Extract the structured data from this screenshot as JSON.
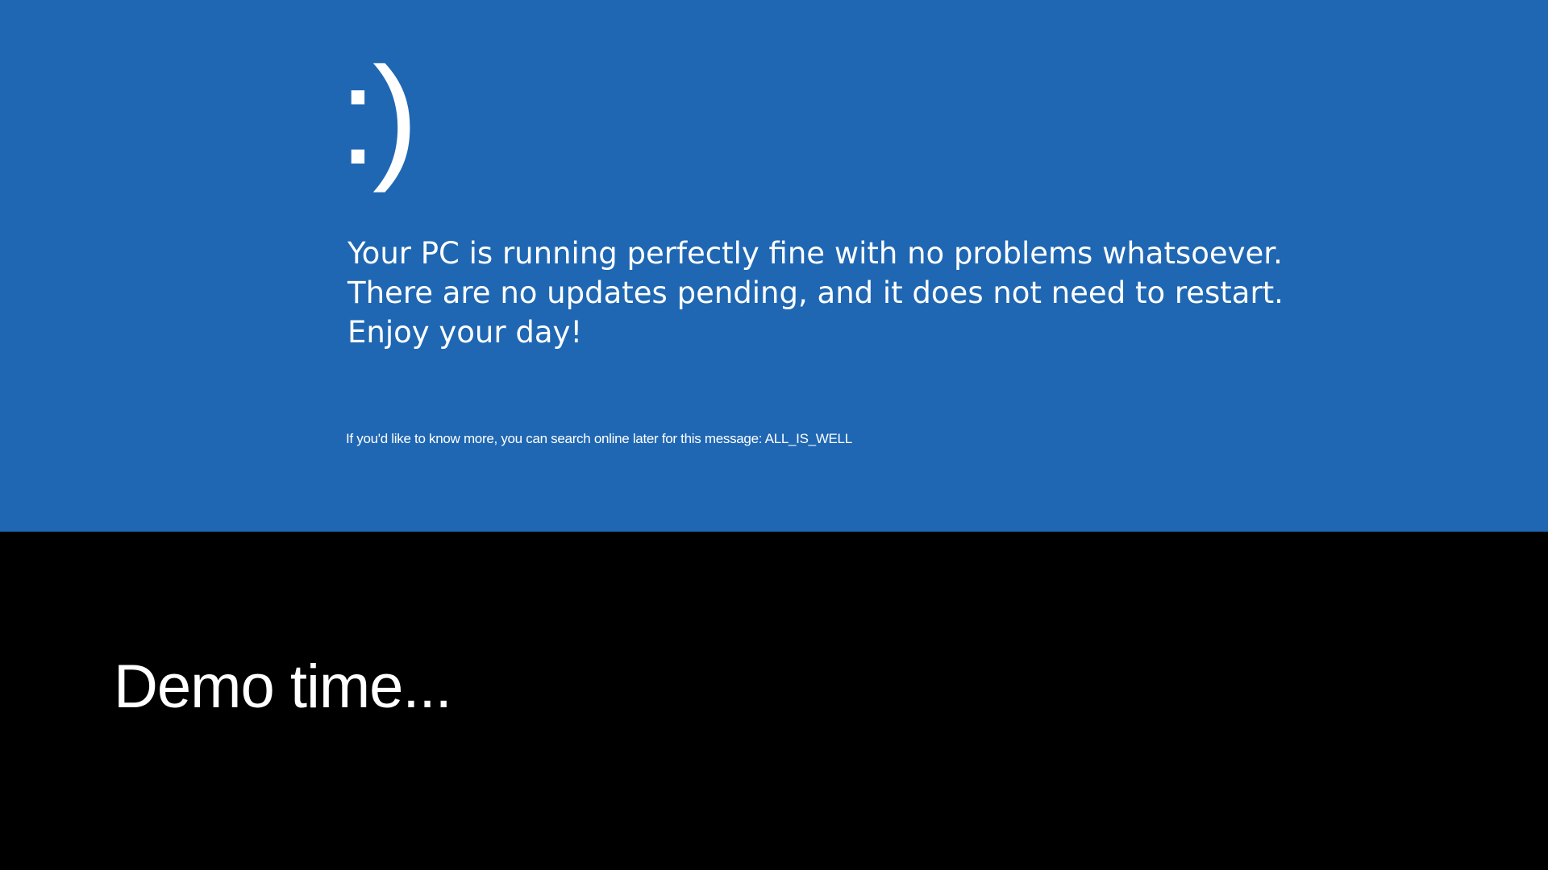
{
  "bsod": {
    "face": ":)",
    "message_lines": [
      "Your PC is running perfectly fine with no problems whatsoever.",
      "There are no updates pending, and it does not need to restart.",
      "Enjoy your day!"
    ],
    "footnote": "If you'd like to know more, you can search online later for this message: ALL_IS_WELL",
    "background_color": "#1f67b3"
  },
  "slide": {
    "caption": "Demo time...",
    "background_color": "#000000"
  }
}
